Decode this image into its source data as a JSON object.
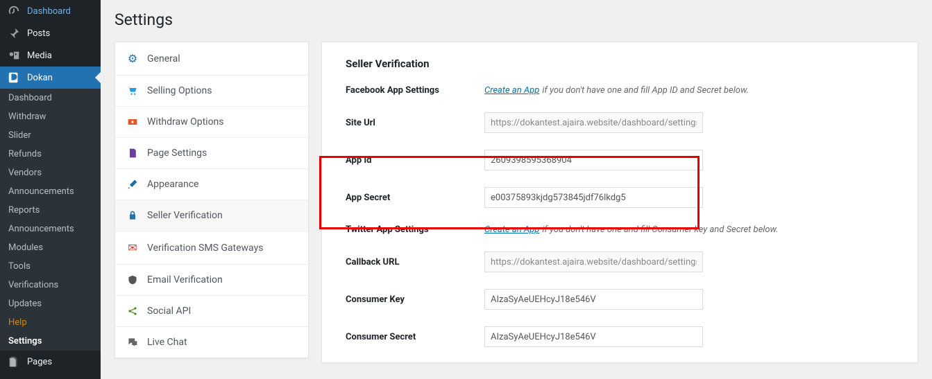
{
  "sidebar": {
    "top": [
      {
        "label": "Dashboard",
        "icon": "gauge"
      },
      {
        "label": "Posts",
        "icon": "pin"
      },
      {
        "label": "Media",
        "icon": "media"
      },
      {
        "label": "Dokan",
        "icon": "dokan",
        "active": true
      }
    ],
    "submenu": [
      "Dashboard",
      "Withdraw",
      "Slider",
      "Refunds",
      "Vendors",
      "Announcements",
      "Reports",
      "Announcements",
      "Modules",
      "Tools",
      "Verifications",
      "Updates",
      "Help",
      "Settings"
    ],
    "bottom": [
      {
        "label": "Pages",
        "icon": "pages"
      }
    ]
  },
  "page": {
    "title": "Settings"
  },
  "tabs": [
    {
      "label": "General",
      "color": "#2271b1",
      "key": "general"
    },
    {
      "label": "Selling Options",
      "color": "#1ba0e2",
      "key": "selling"
    },
    {
      "label": "Withdraw Options",
      "color": "#e1592a",
      "key": "withdraw"
    },
    {
      "label": "Page Settings",
      "color": "#6b3fa0",
      "key": "pages"
    },
    {
      "label": "Appearance",
      "color": "#1570a6",
      "key": "appearance"
    },
    {
      "label": "Seller Verification",
      "color": "#2271b1",
      "key": "seller-verification",
      "active": true
    },
    {
      "label": "Verification SMS Gateways",
      "color": "#d63638",
      "key": "sms"
    },
    {
      "label": "Email Verification",
      "color": "#555",
      "key": "email"
    },
    {
      "label": "Social API",
      "color": "#4f8a10",
      "key": "social"
    },
    {
      "label": "Live Chat",
      "color": "#555",
      "key": "chat"
    }
  ],
  "panel": {
    "heading": "Seller Verification",
    "facebook": {
      "section_label": "Facebook App Settings",
      "link_text": "Create an App",
      "hint": " if you don't have one and fill App ID and Secret below.",
      "site_url_label": "Site Url",
      "site_url_value": "https://dokantest.ajaira.website/dashboard/settings/",
      "app_id_label": "App Id",
      "app_id_value": "2609398595368904",
      "app_secret_label": "App Secret",
      "app_secret_value": "e00375893kjdg573845jdf76lkdg5"
    },
    "twitter": {
      "section_label": "Twitter App Settings",
      "link_text": "Create an App",
      "hint": " if you don't have one and fill Consumer key and Secret below.",
      "callback_label": "Callback URL",
      "callback_value": "https://dokantest.ajaira.website/dashboard/settings/",
      "consumer_key_label": "Consumer Key",
      "consumer_key_value": "AIzaSyAeUEHcyJ18e546V",
      "consumer_secret_label": "Consumer Secret",
      "consumer_secret_value": "AIzaSyAeUEHcyJ18e546V"
    }
  }
}
